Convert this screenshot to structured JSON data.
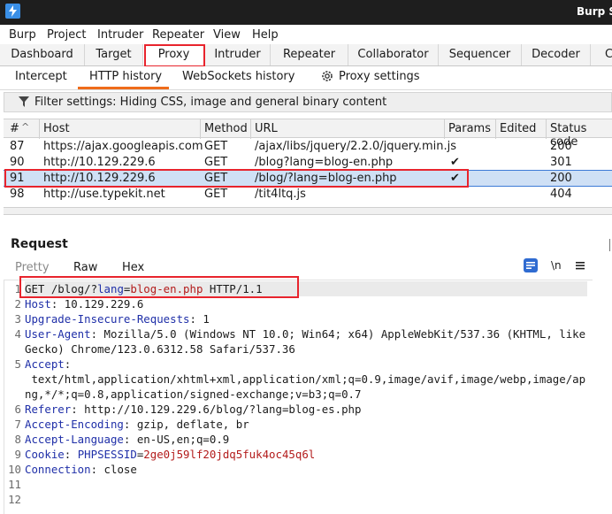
{
  "titlebar": {
    "title": "Burp Su"
  },
  "menu": [
    "Burp",
    "Project",
    "Intruder",
    "Repeater",
    "View",
    "Help"
  ],
  "main_tabs": [
    "Dashboard",
    "Target",
    "Proxy",
    "Intruder",
    "Repeater",
    "Collaborator",
    "Sequencer",
    "Decoder",
    "Com"
  ],
  "proxy_tabs": [
    "Intercept",
    "HTTP history",
    "WebSockets history",
    "Proxy settings"
  ],
  "filter": {
    "text": "Filter settings: Hiding CSS, image and general binary content"
  },
  "table": {
    "columns": [
      "#",
      "Host",
      "Method",
      "URL",
      "Params",
      "Edited",
      "Status code"
    ],
    "sort_indicator": "^",
    "rows": [
      {
        "num": "87",
        "host": "https://ajax.googleapis.com",
        "method": "GET",
        "url": "/ajax/libs/jquery/2.2.0/jquery.min.js",
        "params": "",
        "status": "200"
      },
      {
        "num": "90",
        "host": "http://10.129.229.6",
        "method": "GET",
        "url": "/blog?lang=blog-en.php",
        "params": "✔",
        "status": "301"
      },
      {
        "num": "91",
        "host": "http://10.129.229.6",
        "method": "GET",
        "url": "/blog/?lang=blog-en.php",
        "params": "✔",
        "status": "200"
      },
      {
        "num": "98",
        "host": "http://use.typekit.net",
        "method": "GET",
        "url": "/tit4ltq.js",
        "params": "",
        "status": "404"
      }
    ]
  },
  "request": {
    "title": "Request",
    "tabs": [
      "Pretty",
      "Raw",
      "Hex"
    ],
    "icons": [
      "wrap-toggle-icon",
      "newline-icon",
      "menu-icon"
    ],
    "newline_label": "\\n",
    "line1": {
      "method": "GET ",
      "path": "/blog/?",
      "param": "lang",
      "eq": "=",
      "value": "blog-en.php",
      "proto": " HTTP/1.1"
    },
    "headers": [
      {
        "name": "Host",
        "value": " 10.129.229.6"
      },
      {
        "name": "Upgrade-Insecure-Requests",
        "value": " 1"
      },
      {
        "name": "User-Agent",
        "value": " Mozilla/5.0 (Windows NT 10.0; Win64; x64) AppleWebKit/537.36 (KHTML, like Gecko) Chrome/123.0.6312.58 Safari/537.36"
      },
      {
        "name": "Accept",
        "value": " text/html,application/xhtml+xml,application/xml;q=0.9,image/avif,image/webp,image/apng,*/*;q=0.8,application/signed-exchange;v=b3;q=0.7"
      },
      {
        "name": "Referer",
        "value": " http://10.129.229.6/blog/?lang=blog-es.php"
      },
      {
        "name": "Accept-Encoding",
        "value": " gzip, deflate, br"
      },
      {
        "name": "Accept-Language",
        "value": " en-US,en;q=0.9"
      }
    ],
    "cookie": {
      "name": "Cookie",
      "cname": "PHPSESSID",
      "eq": "=",
      "cval": "2ge0j59lf20jdq5fuk4oc45q6l"
    },
    "connection": {
      "name": "Connection",
      "value": " close"
    },
    "line_numbers": [
      "1",
      "2",
      "3",
      "4",
      "5",
      "6",
      "7",
      "8",
      "9",
      "10",
      "11",
      "12"
    ]
  }
}
